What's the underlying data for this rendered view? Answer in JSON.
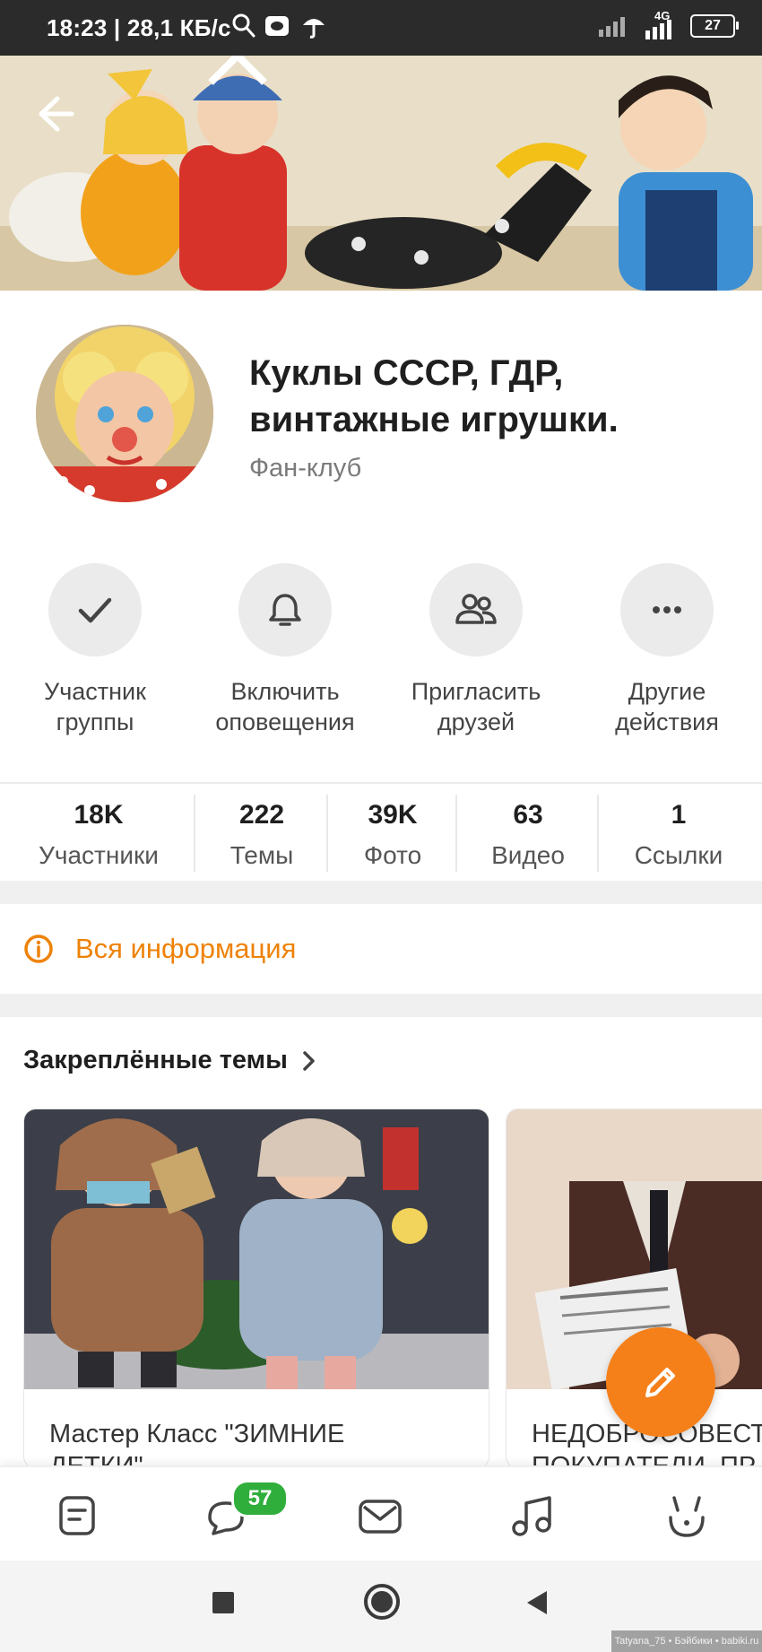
{
  "status_bar": {
    "time_speed": "18:23 | 28,1 КБ/с",
    "network": "4G",
    "battery": "27"
  },
  "group": {
    "name": "Куклы СССР, ГДР, винтажные игрушки.",
    "type": "Фан-клуб"
  },
  "actions": [
    {
      "icon": "check-icon",
      "label": "Участник группы"
    },
    {
      "icon": "bell-icon",
      "label": "Включить оповещения"
    },
    {
      "icon": "people-icon",
      "label": "Пригласить друзей"
    },
    {
      "icon": "more-dots-icon",
      "label": "Другие действия"
    }
  ],
  "stats": [
    {
      "value": "18K",
      "label": "Участники"
    },
    {
      "value": "222",
      "label": "Темы"
    },
    {
      "value": "39K",
      "label": "Фото"
    },
    {
      "value": "63",
      "label": "Видео"
    },
    {
      "value": "1",
      "label": "Ссылки"
    }
  ],
  "info_link": "Вся информация",
  "pinned": {
    "heading": "Закреплённые темы",
    "cards": [
      {
        "title_line1": "Мастер Класс \"ЗИМНИЕ",
        "title_line2": "ДЕТКИ\""
      },
      {
        "title_line1": "НЕДОБРОСОВЕСТ",
        "title_line2": "ПОКУПАТЕЛИ. ПР"
      }
    ]
  },
  "bottom_nav": {
    "badge_count": "57",
    "tabs": [
      "feed-icon",
      "discussions-icon",
      "messages-icon",
      "music-icon",
      "events-icon"
    ]
  },
  "watermark": "Tatyana_75 • Бэйбики • babiki.ru",
  "colors": {
    "accent": "#ee8208",
    "fab": "#f5801a",
    "badge": "#2fae3b",
    "status_bar": "#2b2b2b"
  }
}
